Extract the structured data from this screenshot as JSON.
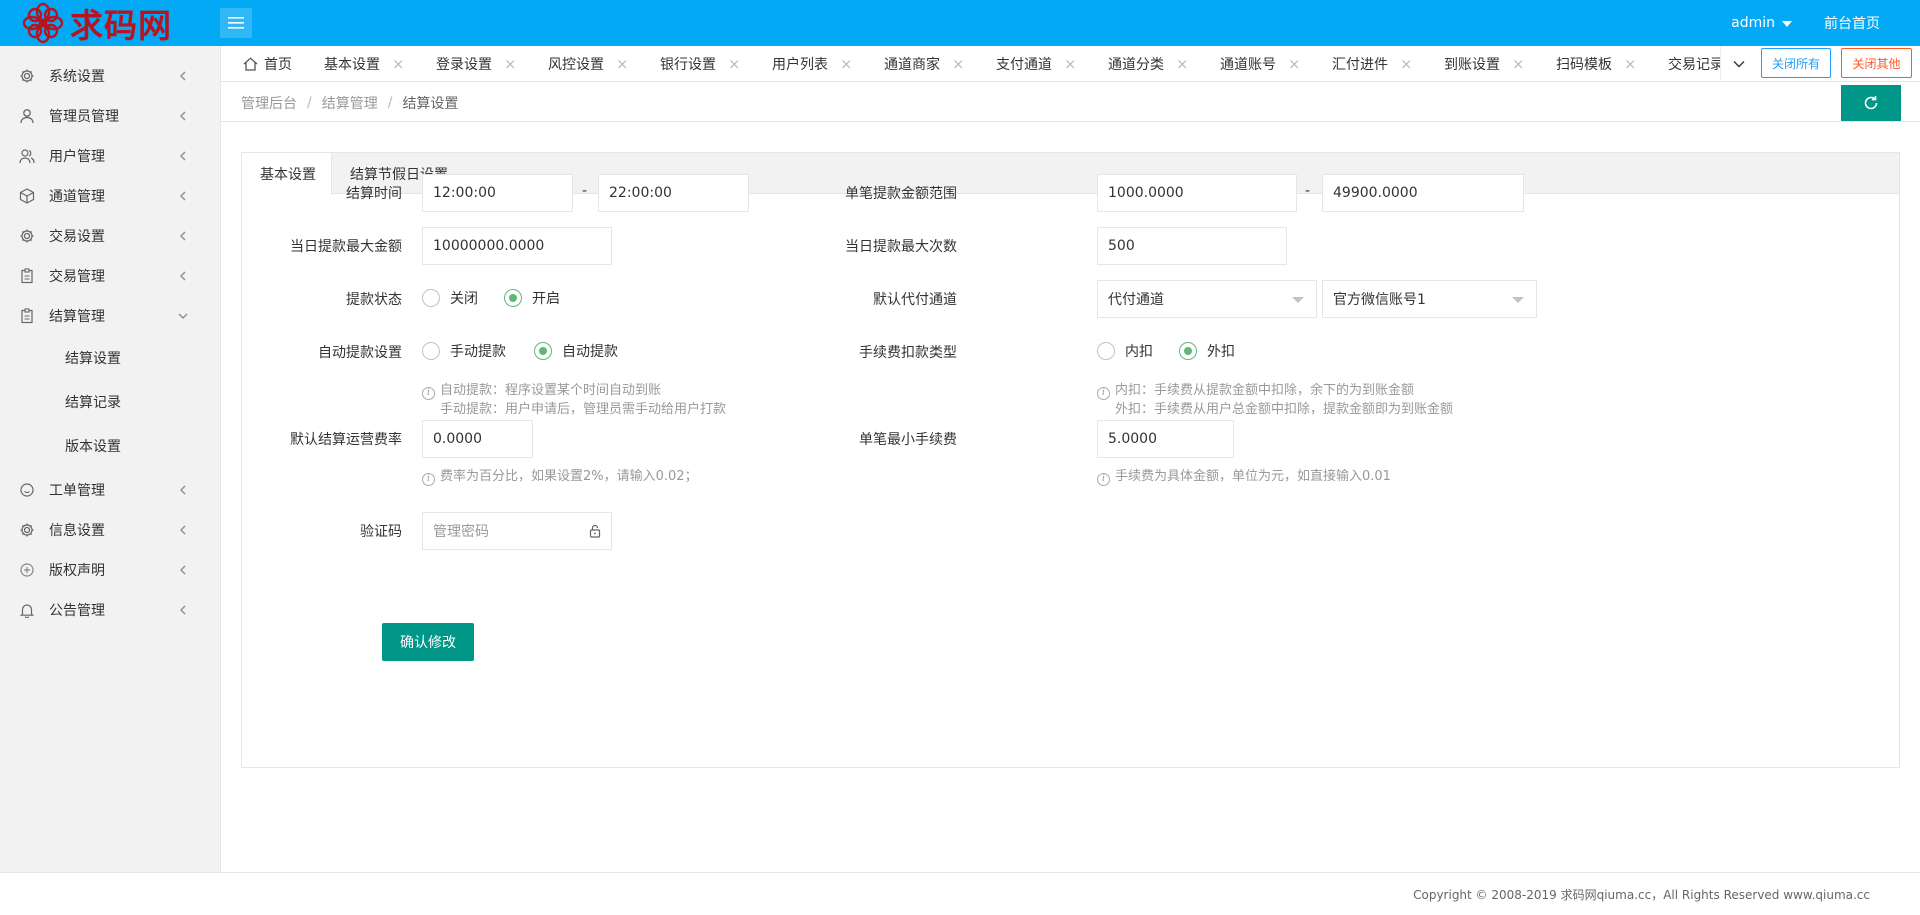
{
  "header": {
    "logo_text": "求码网",
    "user": "admin",
    "front_link": "前台首页"
  },
  "sidebar": {
    "items": [
      {
        "label": "系统设置",
        "icon": "gear-icon"
      },
      {
        "label": "管理员管理",
        "icon": "person-icon"
      },
      {
        "label": "用户管理",
        "icon": "users-icon"
      },
      {
        "label": "通道管理",
        "icon": "cube-icon"
      },
      {
        "label": "交易设置",
        "icon": "gear-icon"
      },
      {
        "label": "交易管理",
        "icon": "clipboard-icon"
      },
      {
        "label": "结算管理",
        "icon": "clipboard-icon"
      },
      {
        "label": "工单管理",
        "icon": "smile-icon"
      },
      {
        "label": "信息设置",
        "icon": "gear-icon"
      },
      {
        "label": "版权声明",
        "icon": "plus-circle-icon"
      },
      {
        "label": "公告管理",
        "icon": "bell-icon"
      }
    ],
    "sub_items": [
      "结算设置",
      "结算记录",
      "版本设置"
    ]
  },
  "tabs": {
    "home": "首页",
    "items": [
      "基本设置",
      "登录设置",
      "风控设置",
      "银行设置",
      "用户列表",
      "通道商家",
      "支付通道",
      "通道分类",
      "通道账号",
      "汇付进件",
      "到账设置",
      "扫码模板",
      "交易记录"
    ],
    "close_all": "关闭所有",
    "close_other": "关闭其他"
  },
  "breadcrumb": [
    "管理后台",
    "结算管理",
    "结算设置"
  ],
  "card": {
    "tabs": [
      "基本设置",
      "结算节假日设置"
    ]
  },
  "form": {
    "settle_time_label": "结算时间",
    "settle_time_start": "12:00:00",
    "settle_time_end": "22:00:00",
    "dash": "-",
    "amount_range_label": "单笔提款金额范围",
    "amount_min": "1000.0000",
    "amount_max": "49900.0000",
    "daily_max_amount_label": "当日提款最大金额",
    "daily_max_amount": "10000000.0000",
    "daily_max_count_label": "当日提款最大次数",
    "daily_max_count": "500",
    "withdraw_status_label": "提款状态",
    "withdraw_status_off": "关闭",
    "withdraw_status_on": "开启",
    "default_channel_label": "默认代付通道",
    "default_channel_select1": "代付通道",
    "default_channel_select2": "官方微信账号1",
    "auto_withdraw_label": "自动提款设置",
    "auto_withdraw_manual": "手动提款",
    "auto_withdraw_auto": "自动提款",
    "auto_withdraw_hint1": "自动提款：程序设置某个时间自动到账",
    "auto_withdraw_hint2": "手动提款：用户申请后，管理员需手动给用户打款",
    "fee_type_label": "手续费扣款类型",
    "fee_type_inner": "内扣",
    "fee_type_outer": "外扣",
    "fee_type_hint1": "内扣：手续费从提款金额中扣除，余下的为到账金额",
    "fee_type_hint2": "外扣：手续费从用户总金额中扣除，提款金额即为到账金额",
    "op_rate_label": "默认结算运营费率",
    "op_rate": "0.0000",
    "op_rate_hint": "费率为百分比，如果设置2%，请输入0.02；",
    "min_fee_label": "单笔最小手续费",
    "min_fee": "5.0000",
    "min_fee_hint": "手续费为具体金额，单位为元，如直接输入0.01",
    "captcha_label": "验证码",
    "captcha_placeholder": "管理密码",
    "submit": "确认修改"
  },
  "footer": "Copyright © 2008-2019 求码网qiuma.cc，All Rights Reserved www.qiuma.cc",
  "colors": {
    "header_bg": "#03a9f4",
    "primary_green": "#009688",
    "radio_checked": "#5fb878",
    "close_all_blue": "#1e9fff",
    "close_other_red": "#ff5722",
    "logo_red": "#b8131e"
  }
}
